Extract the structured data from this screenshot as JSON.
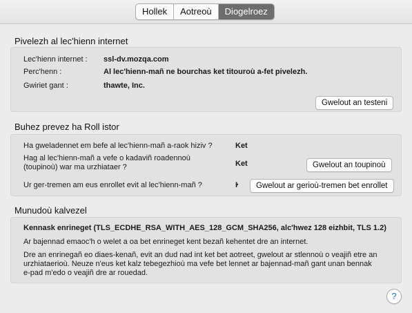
{
  "tabs": [
    {
      "label": "Hollek",
      "active": false
    },
    {
      "label": "Aotreoù",
      "active": false
    },
    {
      "label": "Diogelroez",
      "active": true
    }
  ],
  "identity": {
    "title": "Pivelezh al lec'hienn internet",
    "site_label": "Lec'hienn internet :",
    "site_value": "ssl-dv.mozqa.com",
    "owner_label": "Perc'henn :",
    "owner_value": "Al lec'hienn-mañ ne bourchas ket titouroù a-fet pivelezh.",
    "verified_label": "Gwiriet gant :",
    "verified_value": "thawte, Inc.",
    "view_cert_button": "Gwelout an testeni"
  },
  "privacy": {
    "title": "Buhez prevez ha Roll istor",
    "q1": "Ha gweladennet em befe al lec'hienn-mañ a-raok hiziv ?",
    "a1": "Ket",
    "q2_line1": "Hag al lec'hienn-mañ a vefe o kadaviñ roadennoù",
    "q2_line2": "(toupinoù) war ma urzhiataer ?",
    "a2": "Ket",
    "cookies_button": "Gwelout an toupinoù",
    "q3": "Ur ger-tremen am eus enrollet evit al lec'hienn-mañ ?",
    "a3": "K",
    "passwords_button": "Gwelout ar gerioù-tremen bet enrollet"
  },
  "technical": {
    "title": "Munudoù kalvezel",
    "headline": "Kennask enrineget (TLS_ECDHE_RSA_WITH_AES_128_GCM_SHA256, alc'hwez 128 eizhbit, TLS 1.2)",
    "para1": "Ar bajennad emaoc'h o welet a oa bet enrineget kent bezañ kehentet dre an internet.",
    "para2_line1": "Dre an enrinegañ eo diaes-kenañ, evit an dud nad int ket bet aotreet, gwelout ar stlennoù o veajiñ etre an",
    "para2_line2": "urzhiataerioù. Neuze n'eus ket kalz tebegezhioù ma vefe bet lennet ar bajennad-mañ gant unan bennak",
    "para2_line3": "e-pad m'edo o veajiñ dre ar rouedad."
  },
  "help": {
    "glyph": "?"
  }
}
